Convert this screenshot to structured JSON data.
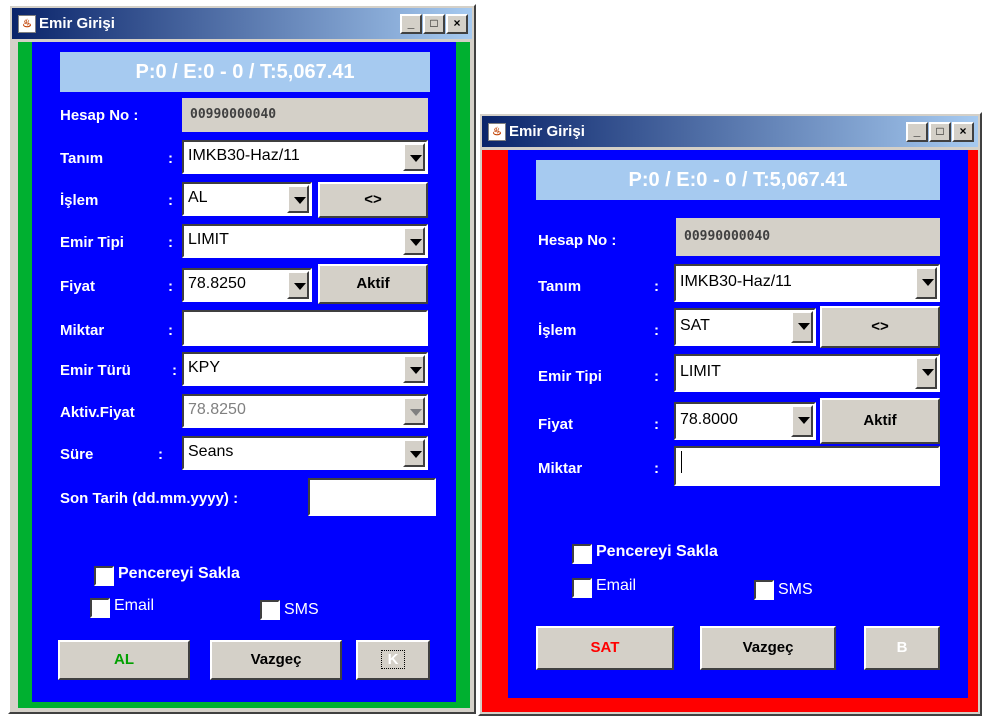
{
  "window_left": {
    "title": "Emir Girişi",
    "header": "P:0 / E:0 - 0 / T:5,067.41",
    "frame_color": "#00b030",
    "fields": {
      "hesap_no": {
        "label": "Hesap No :",
        "value": "00990000040"
      },
      "tanim": {
        "label": "Tanım",
        "value": "IMKB30-Haz/11"
      },
      "islem": {
        "label": "İşlem",
        "value": "AL",
        "swap_button": "<>"
      },
      "emir_tipi": {
        "label": "Emir Tipi",
        "value": "LIMIT"
      },
      "fiyat": {
        "label": "Fiyat",
        "value": "78.8250",
        "aktif_button": "Aktif"
      },
      "miktar": {
        "label": "Miktar",
        "value": ""
      },
      "emir_turu": {
        "label": "Emir Türü",
        "value": "KPY"
      },
      "aktiv_fiyat": {
        "label": "Aktiv.Fiyat",
        "value": "78.8250"
      },
      "sure": {
        "label": "Süre",
        "value": "Seans"
      },
      "son_tarih": {
        "label": "Son Tarih (dd.mm.yyyy) :",
        "value": ""
      }
    },
    "checkboxes": {
      "pencereyi_sakla": "Pencereyi Sakla",
      "email": "Email",
      "sms": "SMS"
    },
    "buttons": {
      "action": "AL",
      "action_color": "#00a000",
      "cancel": "Vazgeç",
      "extra": "K"
    }
  },
  "window_right": {
    "title": "Emir Girişi",
    "header": "P:0 / E:0 - 0 / T:5,067.41",
    "frame_color": "#ff0000",
    "fields": {
      "hesap_no": {
        "label": "Hesap No :",
        "value": "00990000040"
      },
      "tanim": {
        "label": "Tanım",
        "value": "IMKB30-Haz/11"
      },
      "islem": {
        "label": "İşlem",
        "value": "SAT",
        "swap_button": "<>"
      },
      "emir_tipi": {
        "label": "Emir Tipi",
        "value": "LIMIT"
      },
      "fiyat": {
        "label": "Fiyat",
        "value": "78.8000",
        "aktif_button": "Aktif"
      },
      "miktar": {
        "label": "Miktar",
        "value": ""
      }
    },
    "checkboxes": {
      "pencereyi_sakla": "Pencereyi Sakla",
      "email": "Email",
      "sms": "SMS"
    },
    "buttons": {
      "action": "SAT",
      "action_color": "#ff0000",
      "cancel": "Vazgeç",
      "extra": "B"
    }
  },
  "ui": {
    "colon": ":"
  }
}
